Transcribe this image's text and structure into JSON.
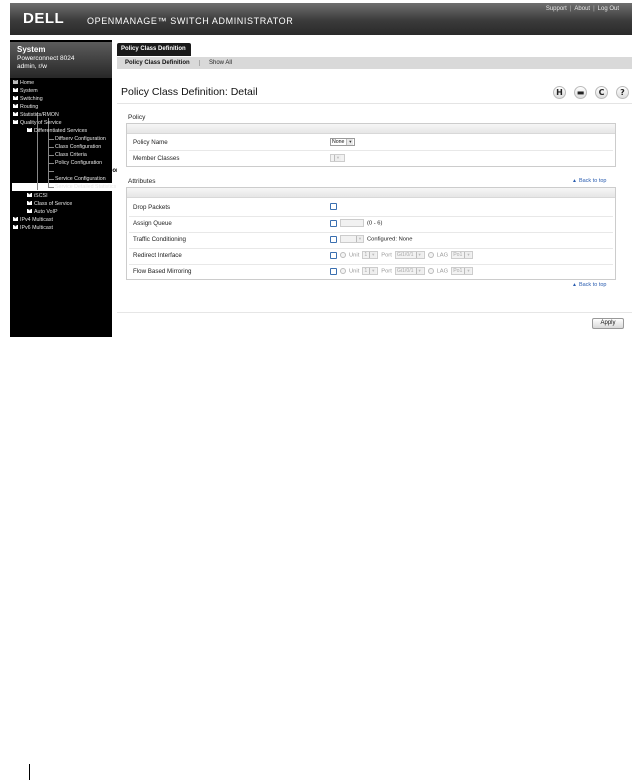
{
  "header": {
    "logo": "DELL",
    "app_title": "OPENMANAGE™ SWITCH ADMINISTRATOR",
    "links": [
      "Support",
      "About",
      "Log Out"
    ]
  },
  "system": {
    "title": "System",
    "model": "Powerconnect 8024",
    "user": "admin, r/w"
  },
  "nav": {
    "home": "Home",
    "system": "System",
    "switching": "Switching",
    "routing": "Routing",
    "statistics": "Statistics/RMON",
    "qos": "Quality of Service",
    "diffserv": "Differentiated Services",
    "diffserv_items": [
      "Diffserv Configuration",
      "Class Configuration",
      "Class Criteria",
      "Policy Configuration",
      "Policy Class Definition",
      "Service Configuration",
      "Service Detailed Statistics"
    ],
    "iscsi": "iSCSI",
    "cos": "Class of Service",
    "voip": "Auto VoIP",
    "ipv4mc": "IPv4 Multicast",
    "ipv6mc": "IPv6 Multicast",
    "selected": "Policy Class Definition"
  },
  "tabs": {
    "main": "Policy Class Definition",
    "sub": [
      "Policy Class Definition",
      "Show All"
    ]
  },
  "page": {
    "title": "Policy Class Definition: Detail",
    "icons": [
      "save-icon",
      "print-icon",
      "refresh-icon",
      "help-icon"
    ]
  },
  "policy_section": {
    "label": "Policy",
    "policy_name_label": "Policy Name",
    "policy_name_value": "None",
    "member_classes_label": "Member Classes"
  },
  "attributes_section": {
    "label": "Attributes",
    "back_to_top": "Back to top",
    "drop_packets_label": "Drop Packets",
    "assign_queue_label": "Assign Queue",
    "assign_queue_range": "(0 - 6)",
    "traffic_conditioning_label": "Traffic Conditioning",
    "traffic_conditioning_configured": "Configured: None",
    "redirect_label": "Redirect Interface",
    "mirror_label": "Flow Based Mirroring",
    "unit_label": "Unit",
    "unit_value": "1",
    "port_label": "Port",
    "port_value": "Gi1/0/1",
    "lag_label": "LAG",
    "lag_value": "Po1"
  },
  "apply_label": "Apply",
  "colors": {
    "header_bg": "#3b3b3b",
    "nav_bg": "#000000",
    "link": "#2a5db0",
    "checkbox": "#3a6fb0"
  }
}
